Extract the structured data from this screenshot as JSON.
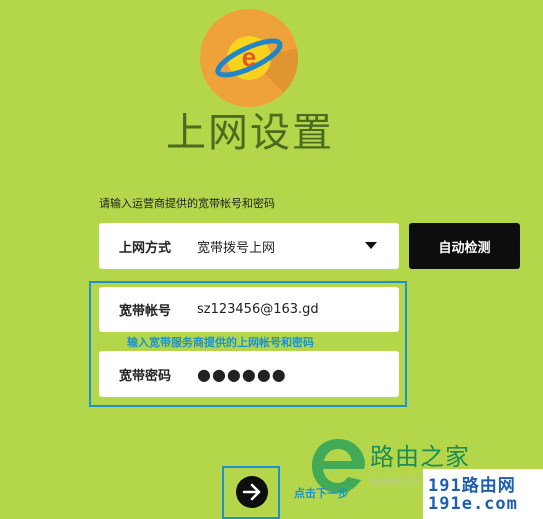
{
  "page": {
    "title": "上网设置",
    "instruction": "请输入运营商提供的宽带帐号和密码"
  },
  "connection": {
    "label": "上网方式",
    "value": "宽带拨号上网",
    "auto_detect_label": "自动检测"
  },
  "account": {
    "label": "宽带帐号",
    "value": "sz123456@163.gd"
  },
  "password": {
    "label": "宽带密码",
    "value": "●●●●●●"
  },
  "hint": "输入宽带服务商提供的上网帐号和密码",
  "next": {
    "label": "点击下一步"
  },
  "watermark": {
    "brand": "路由之家",
    "url": "www.hi",
    "code_line1": "191路由网",
    "code_line2": "191e.com"
  },
  "colors": {
    "background": "#b4d64a",
    "accent_blue": "#1c93cf",
    "logo_orange": "#f0a23a",
    "logo_yellow": "#f7d31e"
  },
  "icons": {
    "logo": "browser-e-icon",
    "dropdown": "caret-down-icon",
    "next": "arrow-right-icon",
    "watermark_logo": "leaf-e-icon"
  }
}
